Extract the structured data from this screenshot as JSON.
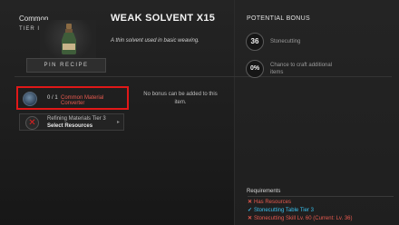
{
  "item": {
    "rarity": "Common",
    "tier": "TIER III",
    "title": "WEAK SOLVENT X15",
    "description": "A thin solvent used in basic weaving.",
    "pin_label": "PIN RECIPE"
  },
  "ingredients": {
    "slot1": {
      "count": "0 / 1",
      "name": "Common Material Converter",
      "icon": "material-converter-icon"
    },
    "slot2": {
      "line1": "Refining Materials Tier 3",
      "line2": "Select Resources",
      "icon": "x-icon"
    }
  },
  "bonus_area": {
    "text": "No bonus can be added to this item."
  },
  "potential_bonus": {
    "heading": "POTENTIAL BONUS",
    "rows": [
      {
        "value": "36",
        "label": "Stonecutting"
      },
      {
        "value": "0%",
        "label": "Chance to craft additional items"
      }
    ]
  },
  "requirements": {
    "heading": "Requirements",
    "items": [
      {
        "mark": "✕",
        "text": "Has Resources",
        "status": "unmet"
      },
      {
        "mark": "✓",
        "text": "Stonecutting Table Tier 3",
        "status": "met"
      },
      {
        "mark": "✕",
        "text": "Stonecutting Skill Lv. 60 (Current: Lv. 36)",
        "status": "unmet"
      }
    ]
  },
  "colors": {
    "highlight": "#e01818",
    "unmet": "#e85a4f",
    "met": "#39c0ee"
  }
}
